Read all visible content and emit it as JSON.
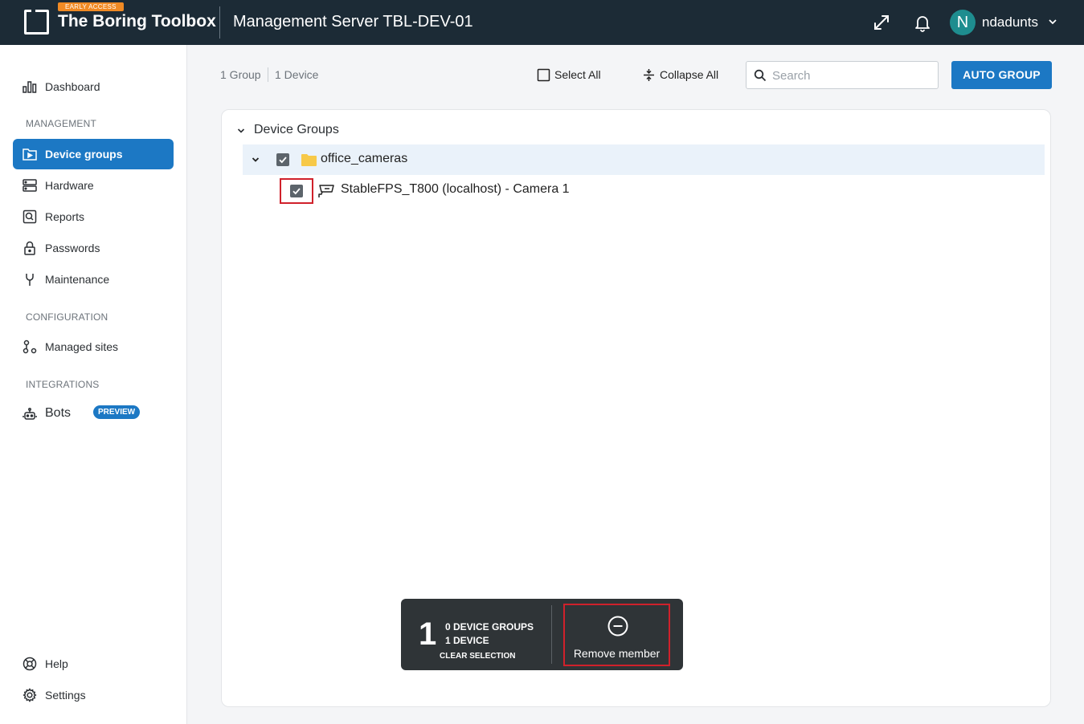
{
  "header": {
    "app_title": "The Boring Toolbox",
    "early_access": "EARLY ACCESS",
    "server_title": "Management Server TBL-DEV-01",
    "user_initial": "N",
    "username": "ndadunts"
  },
  "sidebar": {
    "dashboard": "Dashboard",
    "section_management": "MANAGEMENT",
    "device_groups": "Device groups",
    "hardware": "Hardware",
    "reports": "Reports",
    "passwords": "Passwords",
    "maintenance": "Maintenance",
    "section_configuration": "CONFIGURATION",
    "managed_sites": "Managed sites",
    "section_integrations": "INTEGRATIONS",
    "bots": "Bots",
    "bots_badge": "PREVIEW",
    "help": "Help",
    "settings": "Settings"
  },
  "toolbar": {
    "group_count": "1 Group",
    "device_count": "1 Device",
    "select_all": "Select All",
    "collapse_all": "Collapse All",
    "search_placeholder": "Search",
    "auto_group": "AUTO GROUP"
  },
  "tree": {
    "root_label": "Device Groups",
    "group": {
      "label": "office_cameras",
      "checked": true
    },
    "device": {
      "label": "StableFPS_T800 (localhost) - Camera 1",
      "checked": true
    }
  },
  "selection_bar": {
    "count": "1",
    "groups_text": "0 DEVICE GROUPS",
    "devices_text": "1 DEVICE",
    "clear_selection": "CLEAR SELECTION",
    "remove_member": "Remove member"
  },
  "colors": {
    "topbar": "#1c2b36",
    "accent": "#1c78c4",
    "early_access": "#f08a24",
    "avatar": "#1e8d8f",
    "highlight": "#d0212b"
  }
}
